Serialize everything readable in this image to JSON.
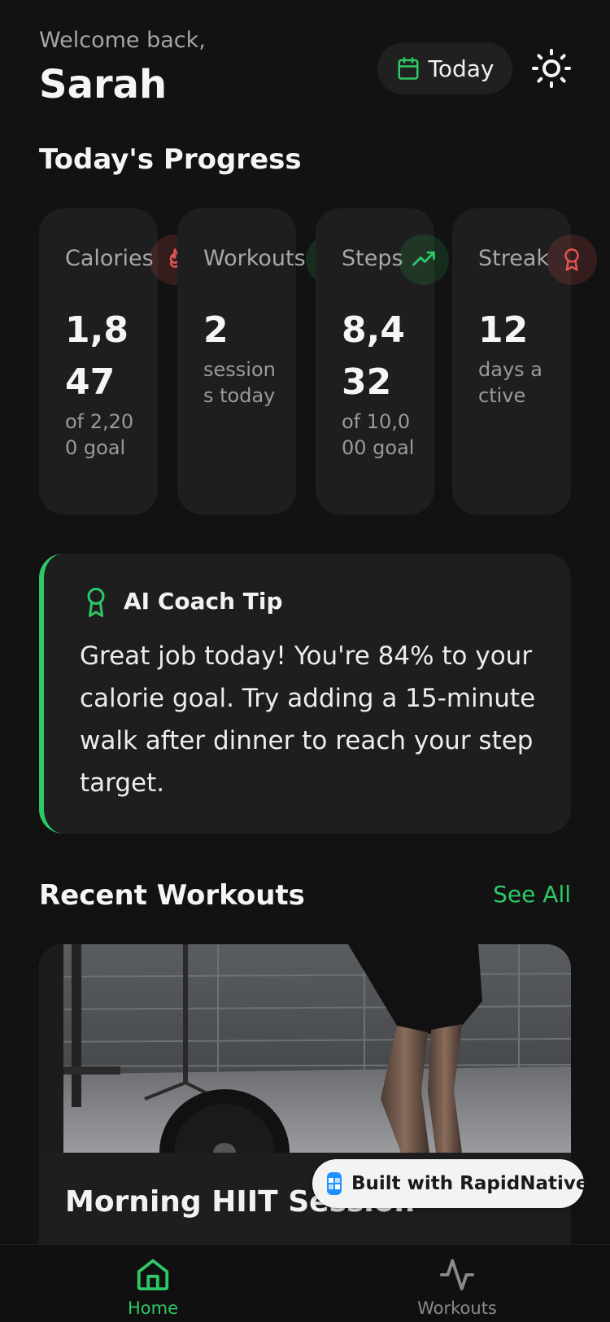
{
  "header": {
    "greeting": "Welcome back,",
    "user_name": "Sarah",
    "date_filter_label": "Today"
  },
  "progress": {
    "title": "Today's Progress",
    "stats": [
      {
        "label": "Calories",
        "value": "1,847",
        "sub": "of 2,200 goal",
        "icon": "flame-icon",
        "color": "#e05454"
      },
      {
        "label": "Workouts",
        "value": "2",
        "sub": "sessions today",
        "icon": "dumbbell-icon",
        "color": "#2ec866"
      },
      {
        "label": "Steps",
        "value": "8,432",
        "sub": "of 10,000 goal",
        "icon": "trending-up-icon",
        "color": "#2ec866"
      },
      {
        "label": "Streak",
        "value": "12",
        "sub": "days active",
        "icon": "award-icon",
        "color": "#e05454"
      }
    ]
  },
  "ai_tip": {
    "title": "AI Coach Tip",
    "body": "Great job today! You're 84% to your calorie goal. Try adding a 15-minute walk after dinner to reach your step target."
  },
  "recent_workouts": {
    "title": "Recent Workouts",
    "see_all_label": "See All",
    "items": [
      {
        "title": "Morning HIIT Session"
      }
    ]
  },
  "badge": {
    "label": "Built with RapidNative"
  },
  "nav": {
    "items": [
      {
        "label": "Home",
        "active": true
      },
      {
        "label": "Workouts",
        "active": false
      }
    ]
  },
  "colors": {
    "accent": "#2ec866",
    "danger": "#e05454",
    "background": "#121212",
    "card": "#1e1e1e"
  }
}
